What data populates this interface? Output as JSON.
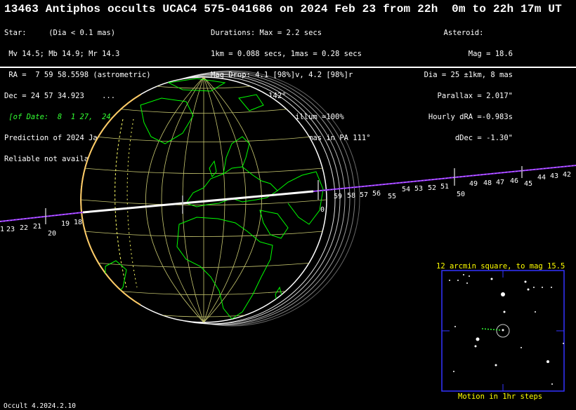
{
  "title": "13463 Antiphos occults UCAC4 575-041686 on 2024 Feb 23 from 22h  0m to 22h 17m UT",
  "star": {
    "line1": "Star:     (Dia < 0.1 mas)",
    "line2": " Mv 14.5; Mb 14.9; Mr 14.3",
    "line3": " RA =  7 59 58.5598 (astrometric)",
    "line4": "Dec = 24 57 34.923    ...",
    "line5": " [of Date:  8  1 27,  24 53 38]",
    "line6": "Prediction of 2024 Jan 21.0",
    "line7": "Reliable not available"
  },
  "event": {
    "line1": "Durations: Max = 2.2 secs",
    "line2": "1km = 0.088 secs, 1mas = 0.28 secs",
    "line3": "Mag Drop: 4.1 [98%]v, 4.2 [98%]r",
    "line4": "Sun : Dist = 142°",
    "line5": "Moon: Dist =  31°, illum =100%",
    "line6": "1σ Err: ±(11.0 x 0.0) mas in PA 111°"
  },
  "asteroid": {
    "line1": "Asteroid:",
    "line2": "Mag = 18.6",
    "line3": "Dia = 25 ±1km, 8 mas",
    "line4": "Parallax = 2.017\"",
    "line5": "Hourly dRA =-0.983s",
    "line6": "dDec = -1.30\""
  },
  "path_labels_right": [
    "0",
    "59",
    "58",
    "57",
    "56",
    "55",
    "54",
    "53",
    "52",
    "51",
    "50",
    "49",
    "48",
    "47",
    "46",
    "45",
    "44",
    "43",
    "42"
  ],
  "path_labels_left": [
    "1",
    "23",
    "22",
    "21",
    "20",
    "19",
    "18"
  ],
  "finder": {
    "title": "12 arcmin square, to mag 15.5",
    "footer": "Motion in 1hr steps"
  },
  "footer": "Occult 4.2024.2.10",
  "colors": {
    "land": "#00ff00",
    "grid": "#c8c870",
    "path": "#9933ff",
    "shadow": "#ffffff",
    "finder_text": "#ffff00",
    "finder_box": "#3333ff"
  }
}
